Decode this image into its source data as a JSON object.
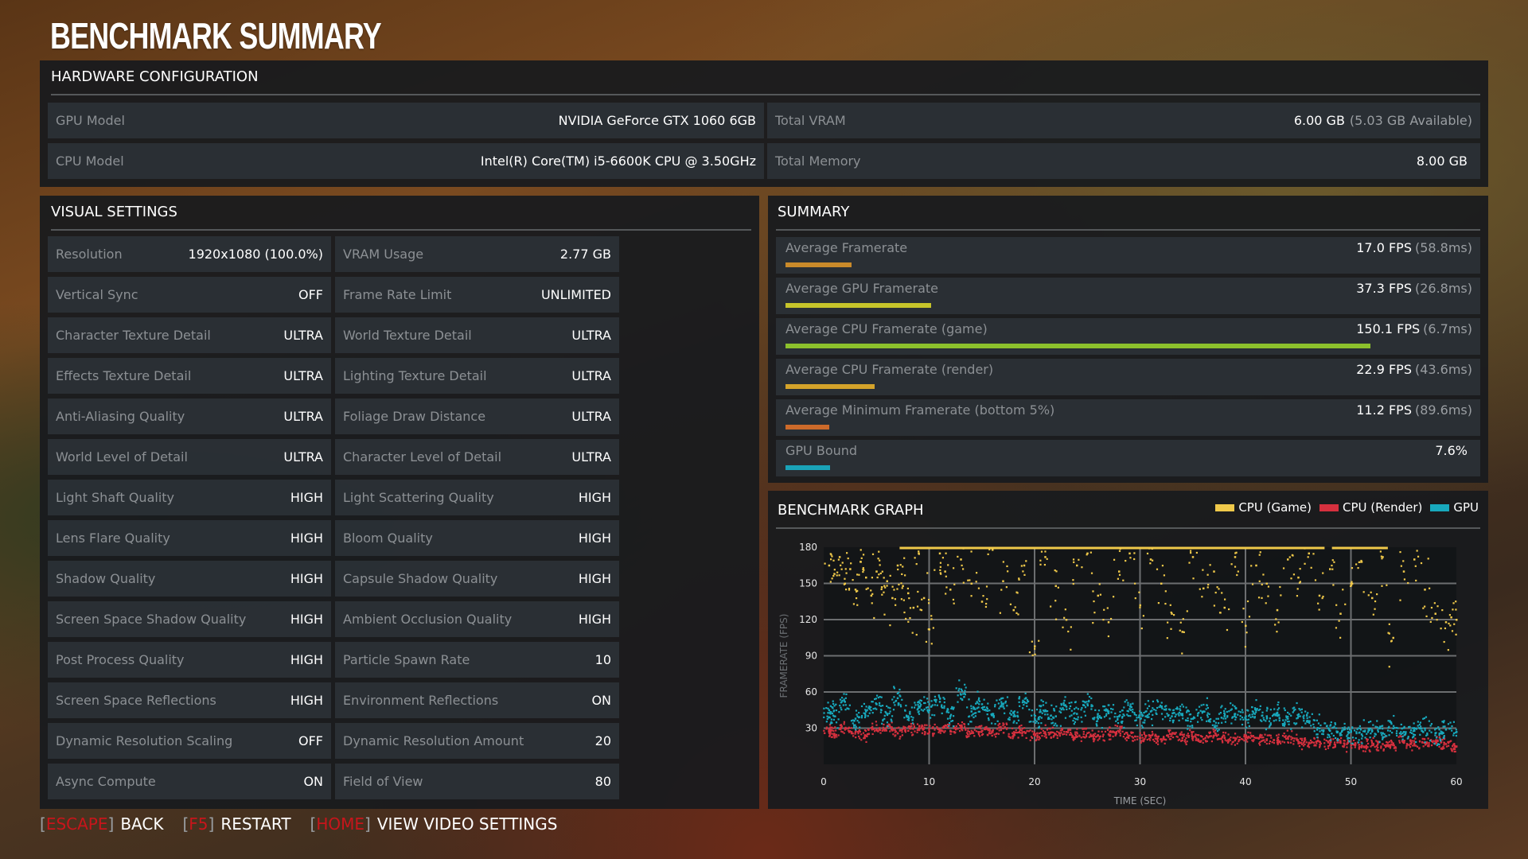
{
  "page_title": "BENCHMARK SUMMARY",
  "hardware": {
    "header": "HARDWARE CONFIGURATION",
    "rows": [
      {
        "label": "GPU Model",
        "value": "NVIDIA GeForce GTX 1060 6GB",
        "sub": ""
      },
      {
        "label": "Total VRAM",
        "value": "6.00 GB",
        "sub": "(5.03 GB Available)"
      },
      {
        "label": "CPU Model",
        "value": "Intel(R) Core(TM) i5-6600K CPU @ 3.50GHz",
        "sub": ""
      },
      {
        "label": "Total Memory",
        "value": "8.00 GB",
        "sub": ""
      }
    ]
  },
  "visual_settings": {
    "header": "VISUAL SETTINGS",
    "rows": [
      [
        {
          "label": "Resolution",
          "value": "1920x1080 (100.0%)"
        },
        {
          "label": "VRAM Usage",
          "value": "2.77 GB"
        }
      ],
      [
        {
          "label": "Vertical Sync",
          "value": "OFF"
        },
        {
          "label": "Frame Rate Limit",
          "value": "UNLIMITED"
        }
      ],
      [
        {
          "label": "Character Texture Detail",
          "value": "ULTRA"
        },
        {
          "label": "World Texture Detail",
          "value": "ULTRA"
        }
      ],
      [
        {
          "label": "Effects Texture Detail",
          "value": "ULTRA"
        },
        {
          "label": "Lighting Texture Detail",
          "value": "ULTRA"
        }
      ],
      [
        {
          "label": "Anti-Aliasing Quality",
          "value": "ULTRA"
        },
        {
          "label": "Foliage Draw Distance",
          "value": "ULTRA"
        }
      ],
      [
        {
          "label": "World Level of Detail",
          "value": "ULTRA"
        },
        {
          "label": "Character Level of Detail",
          "value": "ULTRA"
        }
      ],
      [
        {
          "label": "Light Shaft Quality",
          "value": "HIGH"
        },
        {
          "label": "Light Scattering Quality",
          "value": "HIGH"
        }
      ],
      [
        {
          "label": "Lens Flare Quality",
          "value": "HIGH"
        },
        {
          "label": "Bloom Quality",
          "value": "HIGH"
        }
      ],
      [
        {
          "label": "Shadow Quality",
          "value": "HIGH"
        },
        {
          "label": "Capsule Shadow Quality",
          "value": "HIGH"
        }
      ],
      [
        {
          "label": "Screen Space Shadow Quality",
          "value": "HIGH"
        },
        {
          "label": "Ambient Occlusion Quality",
          "value": "HIGH"
        }
      ],
      [
        {
          "label": "Post Process Quality",
          "value": "HIGH"
        },
        {
          "label": "Particle Spawn Rate",
          "value": "10"
        }
      ],
      [
        {
          "label": "Screen Space Reflections",
          "value": "HIGH"
        },
        {
          "label": "Environment Reflections",
          "value": "ON"
        }
      ],
      [
        {
          "label": "Dynamic Resolution Scaling",
          "value": "OFF"
        },
        {
          "label": "Dynamic Resolution Amount",
          "value": "20"
        }
      ],
      [
        {
          "label": "Async Compute",
          "value": "ON"
        },
        {
          "label": "Field of View",
          "value": "80"
        }
      ]
    ]
  },
  "summary": {
    "header": "SUMMARY",
    "rows": [
      {
        "label": "Average Framerate",
        "value": "17.0 FPS",
        "sub": "(58.8ms)",
        "fill": 0.113,
        "color": "#c98a2a"
      },
      {
        "label": "Average GPU Framerate",
        "value": "37.3 FPS",
        "sub": "(26.8ms)",
        "fill": 0.249,
        "color": "#c6c42a"
      },
      {
        "label": "Average CPU Framerate (game)",
        "value": "150.1 FPS",
        "sub": "(6.7ms)",
        "fill": 1.0,
        "color": "#8cc12c"
      },
      {
        "label": "Average CPU Framerate (render)",
        "value": "22.9 FPS",
        "sub": "(43.6ms)",
        "fill": 0.153,
        "color": "#d4a32a"
      },
      {
        "label": "Average Minimum Framerate (bottom 5%)",
        "value": "11.2 FPS",
        "sub": "(89.6ms)",
        "fill": 0.075,
        "color": "#cc6a2a"
      },
      {
        "label": "GPU Bound",
        "value": "7.6%",
        "sub": "",
        "fill": 0.076,
        "color": "#1aa3b8"
      }
    ]
  },
  "graph": {
    "header": "BENCHMARK GRAPH",
    "legend": [
      {
        "label": "CPU (Game)",
        "color": "#f0c94a"
      },
      {
        "label": "CPU (Render)",
        "color": "#d6303e"
      },
      {
        "label": "GPU",
        "color": "#18a9bd"
      }
    ]
  },
  "chart_data": {
    "type": "scatter",
    "title": "BENCHMARK GRAPH",
    "xlabel": "TIME (SEC)",
    "ylabel": "FRAMERATE (FPS)",
    "xlim": [
      0,
      60
    ],
    "ylim": [
      0,
      180
    ],
    "xticks": [
      0,
      10,
      20,
      30,
      40,
      50,
      60
    ],
    "yticks": [
      30,
      60,
      90,
      120,
      150,
      180
    ],
    "grid": true,
    "legend_position": "top-right",
    "series": [
      {
        "name": "CPU (Game)",
        "color": "#f0c94a",
        "note": "frequently capped at 180 FPS from ~7s to ~53s; scattered 90-180 elsewhere",
        "points": [
          [
            0.5,
            165
          ],
          [
            1,
            158
          ],
          [
            1.5,
            172
          ],
          [
            2,
            150
          ],
          [
            2.5,
            162
          ],
          [
            3,
            145
          ],
          [
            3.5,
            168
          ],
          [
            4,
            155
          ],
          [
            4.5,
            140
          ],
          [
            5,
            160
          ],
          [
            5.5,
            147
          ],
          [
            6,
            152
          ],
          [
            6.5,
            138
          ],
          [
            7,
            165
          ],
          [
            7.5,
            148
          ],
          [
            8,
            142
          ],
          [
            8.5,
            130
          ],
          [
            9,
            175
          ],
          [
            9.5,
            138
          ],
          [
            10,
            112
          ],
          [
            11,
            175
          ],
          [
            11.5,
            160
          ],
          [
            12,
            145
          ],
          [
            13,
            170
          ],
          [
            14,
            150
          ],
          [
            15,
            135
          ],
          [
            16,
            178
          ],
          [
            17,
            152
          ],
          [
            18,
            128
          ],
          [
            19,
            165
          ],
          [
            20,
            98
          ],
          [
            21,
            172
          ],
          [
            22,
            148
          ],
          [
            23,
            120
          ],
          [
            24,
            165
          ],
          [
            25,
            175
          ],
          [
            26,
            140
          ],
          [
            27,
            118
          ],
          [
            28,
            160
          ],
          [
            29,
            175
          ],
          [
            30,
            132
          ],
          [
            31,
            170
          ],
          [
            32,
            150
          ],
          [
            33,
            125
          ],
          [
            34,
            110
          ],
          [
            35,
            172
          ],
          [
            36,
            146
          ],
          [
            37,
            160
          ],
          [
            38,
            130
          ],
          [
            39,
            172
          ],
          [
            40,
            115
          ],
          [
            41,
            165
          ],
          [
            42,
            150
          ],
          [
            43,
            128
          ],
          [
            44,
            170
          ],
          [
            45,
            155
          ],
          [
            46,
            175
          ],
          [
            47,
            140
          ],
          [
            48,
            162
          ],
          [
            49,
            125
          ],
          [
            50,
            150
          ],
          [
            51,
            168
          ],
          [
            52,
            138
          ],
          [
            53,
            172
          ],
          [
            54,
            105
          ],
          [
            55,
            160
          ],
          [
            56,
            170
          ],
          [
            57,
            145
          ],
          [
            58,
            125
          ],
          [
            59,
            118
          ],
          [
            59.5,
            122
          ],
          [
            60,
            120
          ]
        ],
        "cap_segments": [
          [
            7.2,
            47.5
          ],
          [
            48.2,
            53.5
          ]
        ]
      },
      {
        "name": "CPU (Render)",
        "color": "#d6303e",
        "points": [
          [
            0.5,
            28
          ],
          [
            1,
            25
          ],
          [
            2,
            30
          ],
          [
            3,
            27
          ],
          [
            4,
            24
          ],
          [
            5,
            29
          ],
          [
            6,
            31
          ],
          [
            7,
            26
          ],
          [
            8,
            28
          ],
          [
            9,
            30
          ],
          [
            10,
            27
          ],
          [
            11,
            29
          ],
          [
            12,
            28
          ],
          [
            13,
            31
          ],
          [
            14,
            26
          ],
          [
            15,
            28
          ],
          [
            16,
            27
          ],
          [
            17,
            30
          ],
          [
            18,
            25
          ],
          [
            19,
            27
          ],
          [
            20,
            24
          ],
          [
            21,
            26
          ],
          [
            22,
            25
          ],
          [
            23,
            27
          ],
          [
            24,
            23
          ],
          [
            25,
            26
          ],
          [
            26,
            24
          ],
          [
            27,
            25
          ],
          [
            28,
            27
          ],
          [
            29,
            24
          ],
          [
            30,
            22
          ],
          [
            31,
            24
          ],
          [
            32,
            21
          ],
          [
            33,
            25
          ],
          [
            34,
            22
          ],
          [
            35,
            23
          ],
          [
            36,
            21
          ],
          [
            37,
            24
          ],
          [
            38,
            22
          ],
          [
            39,
            20
          ],
          [
            40,
            23
          ],
          [
            41,
            22
          ],
          [
            42,
            21
          ],
          [
            43,
            20
          ],
          [
            44,
            22
          ],
          [
            45,
            19
          ],
          [
            46,
            18
          ],
          [
            47,
            19
          ],
          [
            48,
            17
          ],
          [
            49,
            18
          ],
          [
            50,
            16
          ],
          [
            51,
            15
          ],
          [
            52,
            16
          ],
          [
            53,
            17
          ],
          [
            54,
            16
          ],
          [
            55,
            18
          ],
          [
            56,
            17
          ],
          [
            57,
            18
          ],
          [
            58,
            19
          ],
          [
            59,
            17
          ],
          [
            60,
            15
          ]
        ]
      },
      {
        "name": "GPU",
        "color": "#18a9bd",
        "points": [
          [
            0.5,
            45
          ],
          [
            1,
            40
          ],
          [
            2,
            52
          ],
          [
            3,
            38
          ],
          [
            4,
            44
          ],
          [
            5,
            50
          ],
          [
            6,
            42
          ],
          [
            7,
            55
          ],
          [
            8,
            40
          ],
          [
            9,
            48
          ],
          [
            10,
            45
          ],
          [
            11,
            52
          ],
          [
            12,
            40
          ],
          [
            13,
            58
          ],
          [
            14,
            44
          ],
          [
            15,
            50
          ],
          [
            16,
            42
          ],
          [
            17,
            48
          ],
          [
            18,
            40
          ],
          [
            19,
            52
          ],
          [
            20,
            38
          ],
          [
            21,
            45
          ],
          [
            22,
            40
          ],
          [
            23,
            48
          ],
          [
            24,
            42
          ],
          [
            25,
            50
          ],
          [
            26,
            38
          ],
          [
            27,
            44
          ],
          [
            28,
            40
          ],
          [
            29,
            46
          ],
          [
            30,
            38
          ],
          [
            31,
            44
          ],
          [
            32,
            48
          ],
          [
            33,
            40
          ],
          [
            34,
            42
          ],
          [
            35,
            38
          ],
          [
            36,
            44
          ],
          [
            37,
            36
          ],
          [
            38,
            40
          ],
          [
            39,
            42
          ],
          [
            40,
            38
          ],
          [
            41,
            45
          ],
          [
            42,
            40
          ],
          [
            43,
            42
          ],
          [
            44,
            38
          ],
          [
            45,
            40
          ],
          [
            46,
            36
          ],
          [
            47,
            30
          ],
          [
            48,
            28
          ],
          [
            49,
            26
          ],
          [
            50,
            27
          ],
          [
            51,
            25
          ],
          [
            52,
            28
          ],
          [
            53,
            26
          ],
          [
            54,
            30
          ],
          [
            55,
            27
          ],
          [
            56,
            28
          ],
          [
            57,
            30
          ],
          [
            58,
            26
          ],
          [
            59,
            29
          ],
          [
            60,
            27
          ]
        ]
      }
    ]
  },
  "controls": [
    {
      "key": "ESCAPE",
      "action": "BACK"
    },
    {
      "key": "F5",
      "action": "RESTART"
    },
    {
      "key": "HOME",
      "action": "VIEW VIDEO SETTINGS"
    }
  ]
}
